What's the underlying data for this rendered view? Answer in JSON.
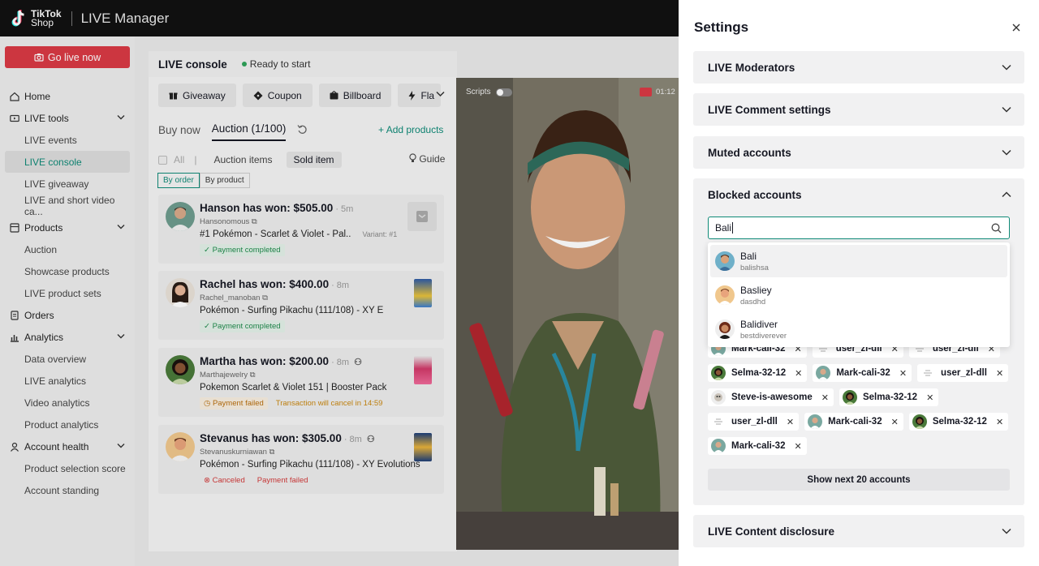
{
  "topbar": {
    "logo_line1": "TikTok",
    "logo_line2": "Shop",
    "app_title": "LIVE Manager"
  },
  "sidebar": {
    "go_live": "Go live now",
    "items": [
      {
        "label": "Home",
        "icon": "home-icon"
      },
      {
        "label": "LIVE tools",
        "icon": "live-tools-icon",
        "expandable": true
      },
      {
        "label": "LIVE events",
        "sub": true
      },
      {
        "label": "LIVE console",
        "sub": true,
        "active": true
      },
      {
        "label": "LIVE giveaway",
        "sub": true
      },
      {
        "label": "LIVE and short video ca...",
        "sub": true
      },
      {
        "label": "Products",
        "icon": "products-icon",
        "expandable": true
      },
      {
        "label": "Auction",
        "sub": true
      },
      {
        "label": "Showcase products",
        "sub": true
      },
      {
        "label": "LIVE product sets",
        "sub": true
      },
      {
        "label": "Orders",
        "icon": "orders-icon"
      },
      {
        "label": "Analytics",
        "icon": "analytics-icon",
        "expandable": true
      },
      {
        "label": "Data overview",
        "sub": true
      },
      {
        "label": "LIVE analytics",
        "sub": true
      },
      {
        "label": "Video analytics",
        "sub": true
      },
      {
        "label": "Product analytics",
        "sub": true
      },
      {
        "label": "Account health",
        "icon": "account-health-icon",
        "expandable": true
      },
      {
        "label": "Product selection score",
        "sub": true
      },
      {
        "label": "Account standing",
        "sub": true
      }
    ]
  },
  "console": {
    "title": "LIVE console",
    "status": "Ready to start",
    "tools": [
      "Giveaway",
      "Coupon",
      "Billboard",
      "Fla"
    ],
    "tabs": [
      "Buy now",
      "Auction (1/100)"
    ],
    "add_products": "Add products",
    "filter_all": "All",
    "filter_items": "Auction items",
    "filter_sold": "Sold item",
    "guide": "Guide",
    "by_order": "By order",
    "by_product": "By product",
    "cards": [
      {
        "title": "Hanson has won: $505.00",
        "time": "· 5m",
        "handle": "Hansonomous",
        "product": "#1 Pokémon - Scarlet & Violet - Pal..",
        "variant": "Variant: #1",
        "badge": "Payment completed",
        "badge2": ""
      },
      {
        "title": "Rachel has won: $400.00",
        "time": "· 8m",
        "handle": "Rachel_manoban",
        "product": "Pokémon - Surfing Pikachu (111/108) - XY E",
        "variant": "",
        "badge": "Payment completed",
        "badge2": ""
      },
      {
        "title": "Martha has won: $200.00",
        "time": "· 8m",
        "handle": "Marthajewelry",
        "product": "Pokemon Scarlet & Violet 151 | Booster Pack",
        "variant": "",
        "badge": "Payment failed",
        "badge2": "Transaction will cancel in 14:59"
      },
      {
        "title": "Stevanus has won: $305.00",
        "time": "· 8m",
        "handle": "Stevanuskurniawan",
        "product": "Pokémon - Surfing Pikachu (111/108) - XY Evolutions",
        "variant": "",
        "badge": "Canceled",
        "badge2": "Payment failed"
      }
    ]
  },
  "video": {
    "scripts_label": "Scripts",
    "timer": "01:12"
  },
  "settings": {
    "title": "Settings",
    "sections": [
      "LIVE Moderators",
      "LIVE Comment settings",
      "Muted accounts",
      "Blocked accounts",
      "LIVE Content disclosure"
    ],
    "search_value": "Bali",
    "dropdown": [
      {
        "name": "Bali",
        "handle": "balishsa"
      },
      {
        "name": "Basliey",
        "handle": "dasdhd"
      },
      {
        "name": "Balidiver",
        "handle": "bestdiverever"
      }
    ],
    "chips": [
      [
        "Mark-cali-32",
        "user_zl-dll",
        "user_zl-dll"
      ],
      [
        "Selma-32-12",
        "Mark-cali-32",
        "user_zl-dll"
      ],
      [
        "Steve-is-awesome",
        "Selma-32-12"
      ],
      [
        "user_zl-dll",
        "Mark-cali-32",
        "Selma-32-12"
      ],
      [
        "Mark-cali-32"
      ]
    ],
    "show_next": "Show next 20 accounts"
  },
  "colors": {
    "accent": "#0f8a77",
    "go_live": "#d93a45",
    "topbar": "#121212"
  }
}
